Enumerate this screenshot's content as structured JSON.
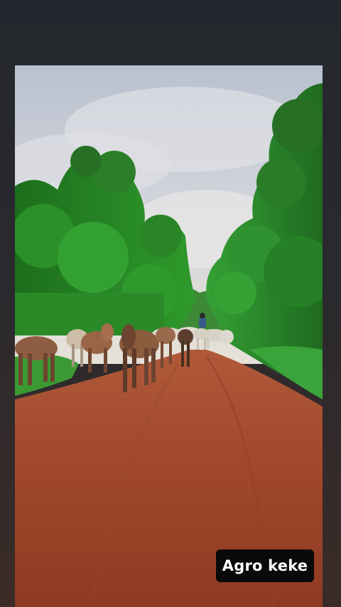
{
  "photo": {
    "subject": "cattle-herd-on-red-dirt-road",
    "colors": {
      "sky": "#c9ced8",
      "foliage": "#2f8a2a",
      "road": "#a84a2c",
      "cattle_light": "#d9d4c8",
      "mules": "#8a5a3c"
    }
  },
  "overlay": {
    "caption": "Agro keke"
  }
}
